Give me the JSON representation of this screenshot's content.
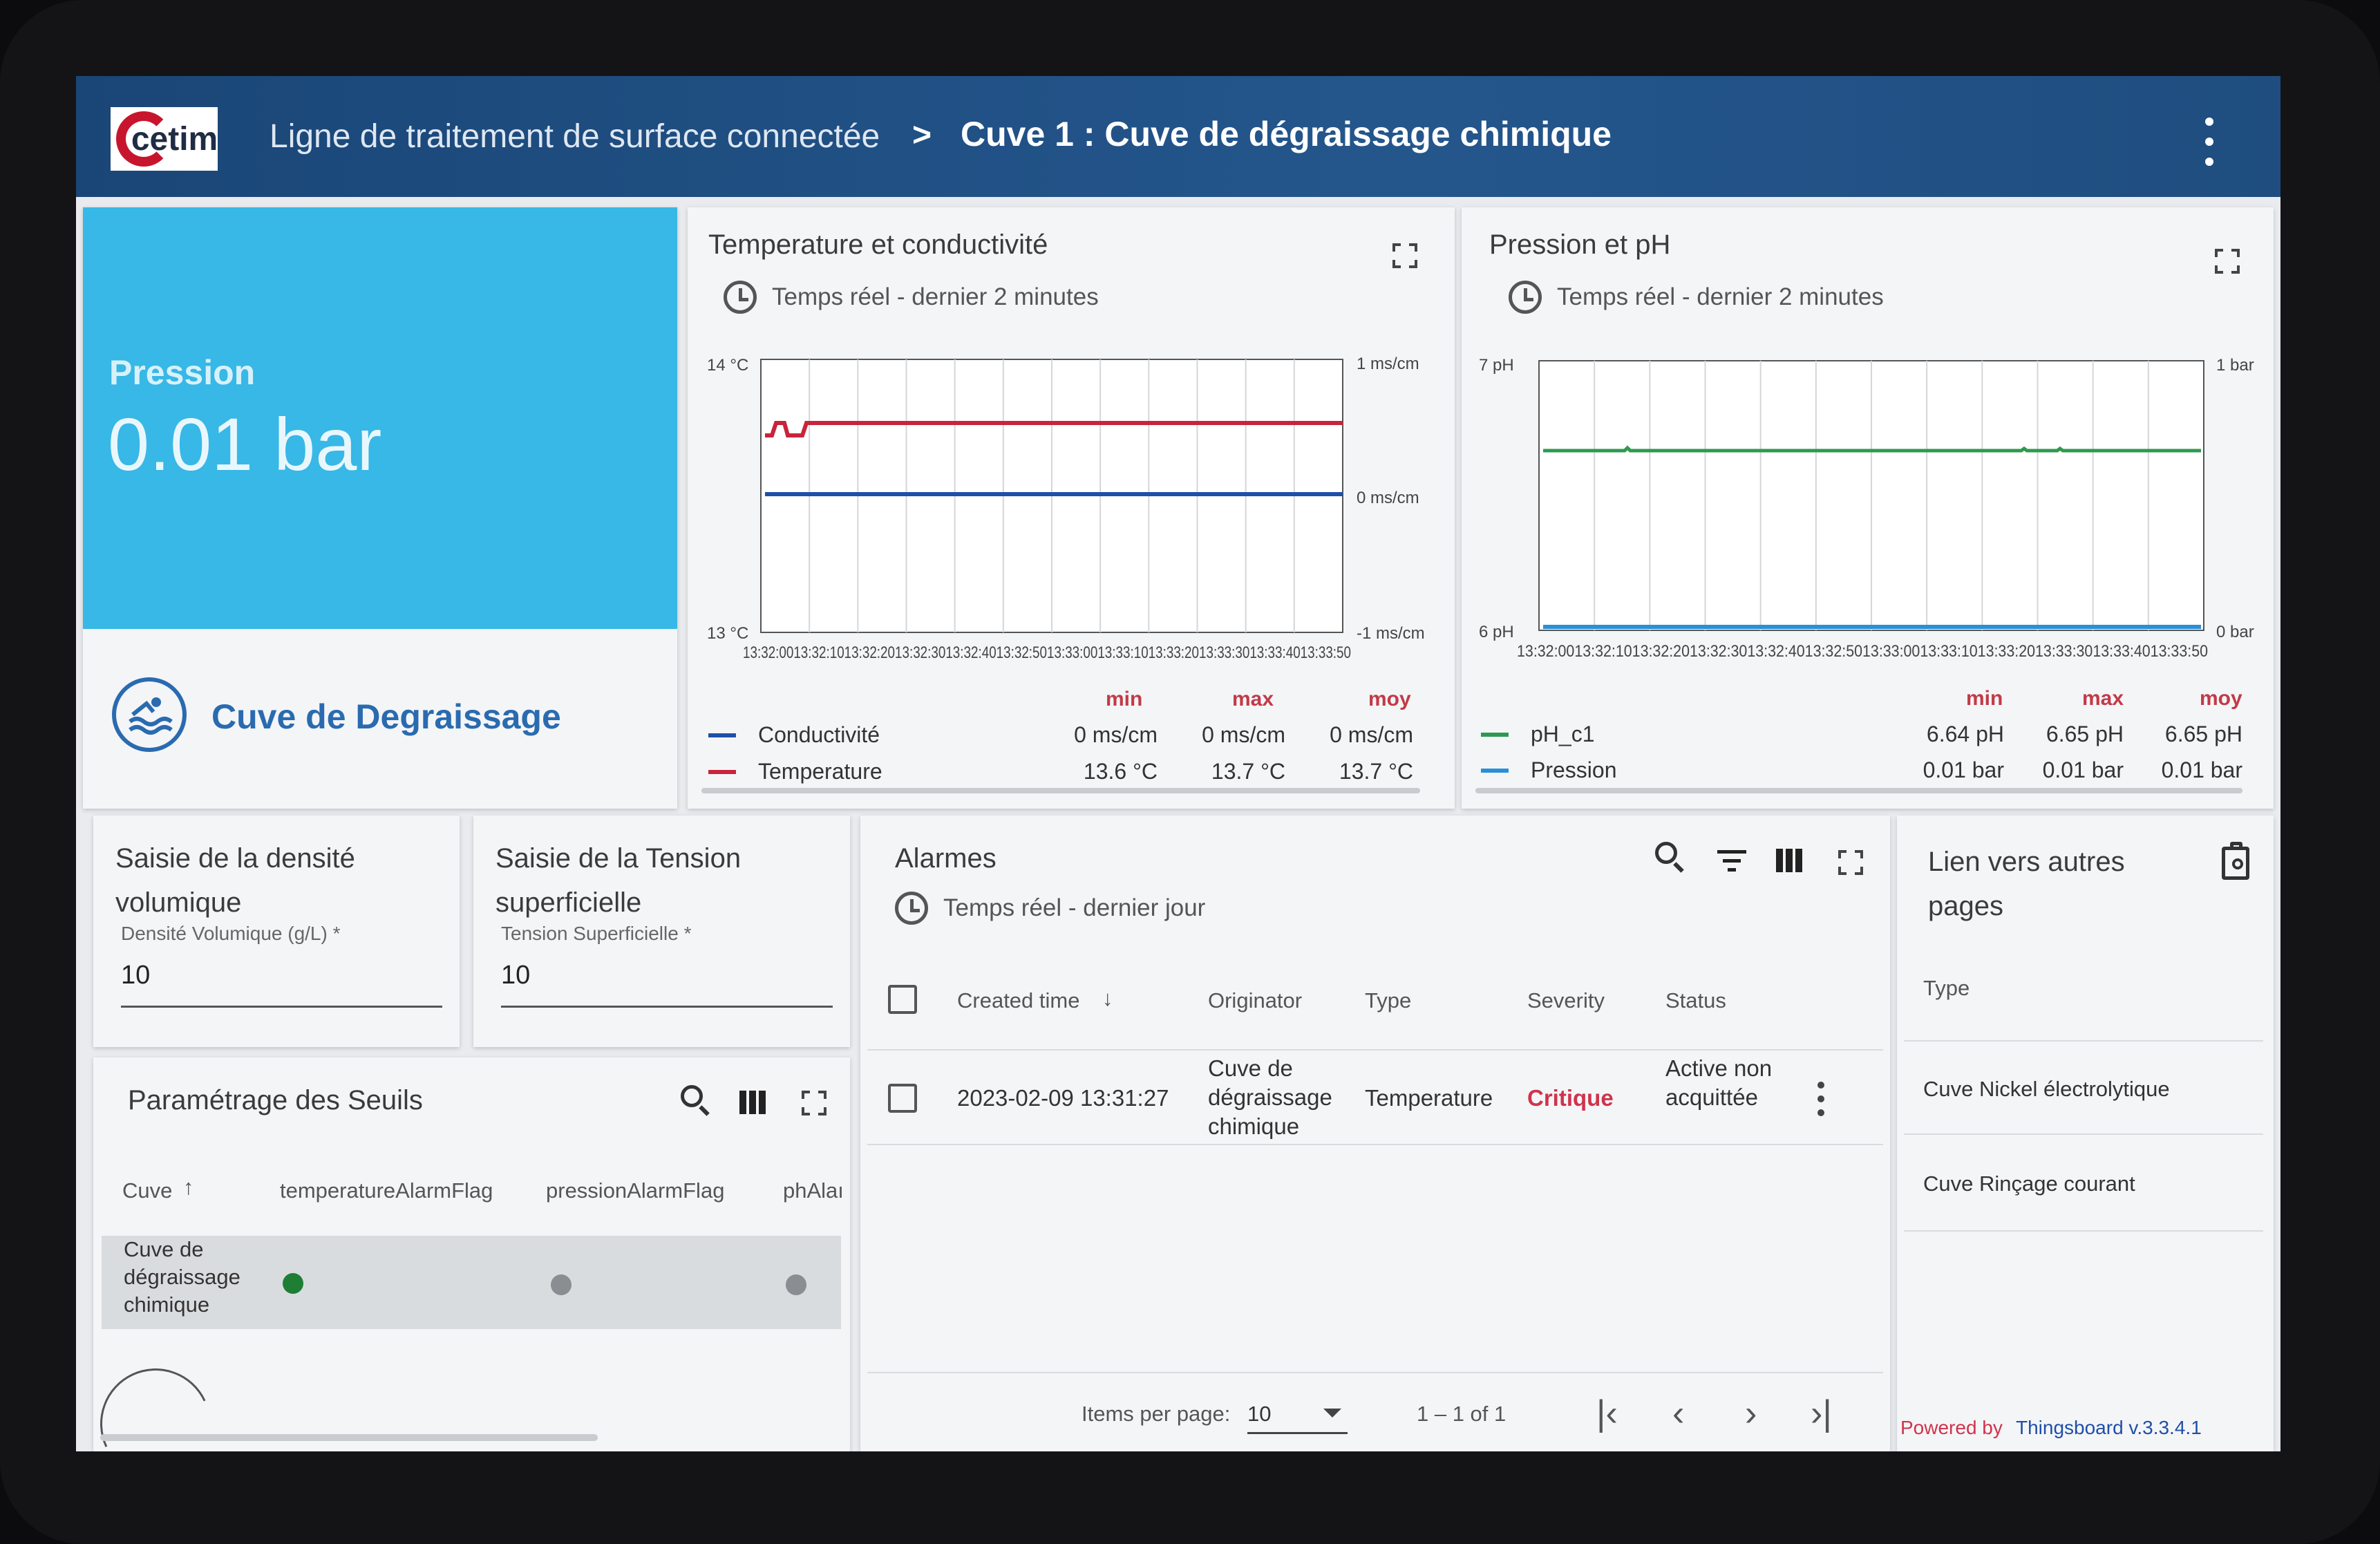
{
  "header": {
    "logo_text": "cetim",
    "breadcrumb_parent": "Ligne de traitement de surface connectée",
    "breadcrumb_separator": ">",
    "breadcrumb_current": "Cuve 1 : Cuve de dégraissage chimique"
  },
  "pression_card": {
    "label": "Pression",
    "value": "0.01 bar",
    "tank_name": "Cuve de Degraissage",
    "icon": "swimming-pool-icon"
  },
  "temp_chart": {
    "title": "Temperature et conductivité",
    "subtitle": "Temps réel - dernier 2 minutes",
    "y_left_top": "14 °C",
    "y_left_bottom": "13 °C",
    "y_right_top": "1 ms/cm",
    "y_right_mid": "0 ms/cm",
    "y_right_bottom": "-1 ms/cm",
    "x_ticks": "13:32:0013:32:1013:32:2013:32:3013:32:4013:32:5013:33:0013:33:1013:33:2013:33:3013:33:4013:33:50",
    "legend_headers": {
      "min": "min",
      "max": "max",
      "avg": "moy"
    },
    "legend": [
      {
        "name": "Conductivité",
        "min": "0 ms/cm",
        "max": "0 ms/cm",
        "avg": "0 ms/cm",
        "color": "#1f4fa8"
      },
      {
        "name": "Temperature",
        "min": "13.6 °C",
        "max": "13.7 °C",
        "avg": "13.7 °C",
        "color": "#c8243c"
      }
    ]
  },
  "ph_chart": {
    "title": "Pression et pH",
    "subtitle": "Temps réel - dernier 2 minutes",
    "y_left_top": "7 pH",
    "y_left_bottom": "6 pH",
    "y_right_top": "1 bar",
    "y_right_bottom": "0 bar",
    "x_ticks": "13:32:0013:32:1013:32:2013:32:3013:32:4013:32:5013:33:0013:33:1013:33:2013:33:3013:33:4013:33:50",
    "legend_headers": {
      "min": "min",
      "max": "max",
      "avg": "moy"
    },
    "legend": [
      {
        "name": "pH_c1",
        "min": "6.64 pH",
        "max": "6.65 pH",
        "avg": "6.65 pH",
        "color": "#2e9a4f"
      },
      {
        "name": "Pression",
        "min": "0.01 bar",
        "max": "0.01 bar",
        "avg": "0.01 bar",
        "color": "#2b8fd6"
      }
    ]
  },
  "chart_data": [
    {
      "type": "line",
      "title": "Temperature et conductivité",
      "x": [
        "13:32:00",
        "13:32:10",
        "13:32:20",
        "13:32:30",
        "13:32:40",
        "13:32:50",
        "13:33:00",
        "13:33:10",
        "13:33:20",
        "13:33:30",
        "13:33:40",
        "13:33:50"
      ],
      "series": [
        {
          "name": "Temperature",
          "unit": "°C",
          "axis": "left",
          "values": [
            13.7,
            13.6,
            13.7,
            13.7,
            13.7,
            13.7,
            13.7,
            13.7,
            13.7,
            13.7,
            13.7,
            13.7
          ]
        },
        {
          "name": "Conductivité",
          "unit": "ms/cm",
          "axis": "right",
          "values": [
            0,
            0,
            0,
            0,
            0,
            0,
            0,
            0,
            0,
            0,
            0,
            0
          ]
        }
      ],
      "ylim_left": [
        13,
        14
      ],
      "ylim_right": [
        -1,
        1
      ]
    },
    {
      "type": "line",
      "title": "Pression et pH",
      "x": [
        "13:32:00",
        "13:32:10",
        "13:32:20",
        "13:32:30",
        "13:32:40",
        "13:32:50",
        "13:33:00",
        "13:33:10",
        "13:33:20",
        "13:33:30",
        "13:33:40",
        "13:33:50"
      ],
      "series": [
        {
          "name": "pH_c1",
          "unit": "pH",
          "axis": "left",
          "values": [
            6.65,
            6.65,
            6.65,
            6.65,
            6.65,
            6.65,
            6.65,
            6.65,
            6.65,
            6.65,
            6.65,
            6.65
          ]
        },
        {
          "name": "Pression",
          "unit": "bar",
          "axis": "right",
          "values": [
            0.01,
            0.01,
            0.01,
            0.01,
            0.01,
            0.01,
            0.01,
            0.01,
            0.01,
            0.01,
            0.01,
            0.01
          ]
        }
      ],
      "ylim_left": [
        6,
        7
      ],
      "ylim_right": [
        0,
        1
      ]
    }
  ],
  "densite": {
    "title": "Saisie de la densité volumique",
    "label": "Densité Volumique (g/L) *",
    "value": "10"
  },
  "tension": {
    "title": "Saisie de la Tension superficielle",
    "label": "Tension Superficielle *",
    "value": "10"
  },
  "seuils": {
    "title": "Paramétrage des Seuils",
    "columns": [
      "Cuve",
      "temperatureAlarmFlag",
      "pressionAlarmFlag",
      "phAlaı"
    ],
    "row": {
      "cuve": "Cuve de dégraissage chimique",
      "temperature": "green",
      "pression": "grey",
      "ph": "grey"
    }
  },
  "alarmes": {
    "title": "Alarmes",
    "subtitle": "Temps réel - dernier jour",
    "columns": [
      "Created time",
      "Originator",
      "Type",
      "Severity",
      "Status"
    ],
    "rows": [
      {
        "created": "2023-02-09 13:31:27",
        "originator": "Cuve de dégraissage chimique",
        "type": "Temperature",
        "severity": "Critique",
        "status": "Active non acquittée"
      }
    ],
    "items_per_page_label": "Items per page:",
    "items_per_page": "10",
    "range": "1 – 1 of 1"
  },
  "liens": {
    "title": "Lien vers autres pages",
    "column": "Type",
    "items": [
      "Cuve Nickel électrolytique",
      "Cuve Rinçage courant"
    ],
    "powered_prefix": "Powered by",
    "powered_link": "Thingsboard v.3.3.4.1"
  }
}
